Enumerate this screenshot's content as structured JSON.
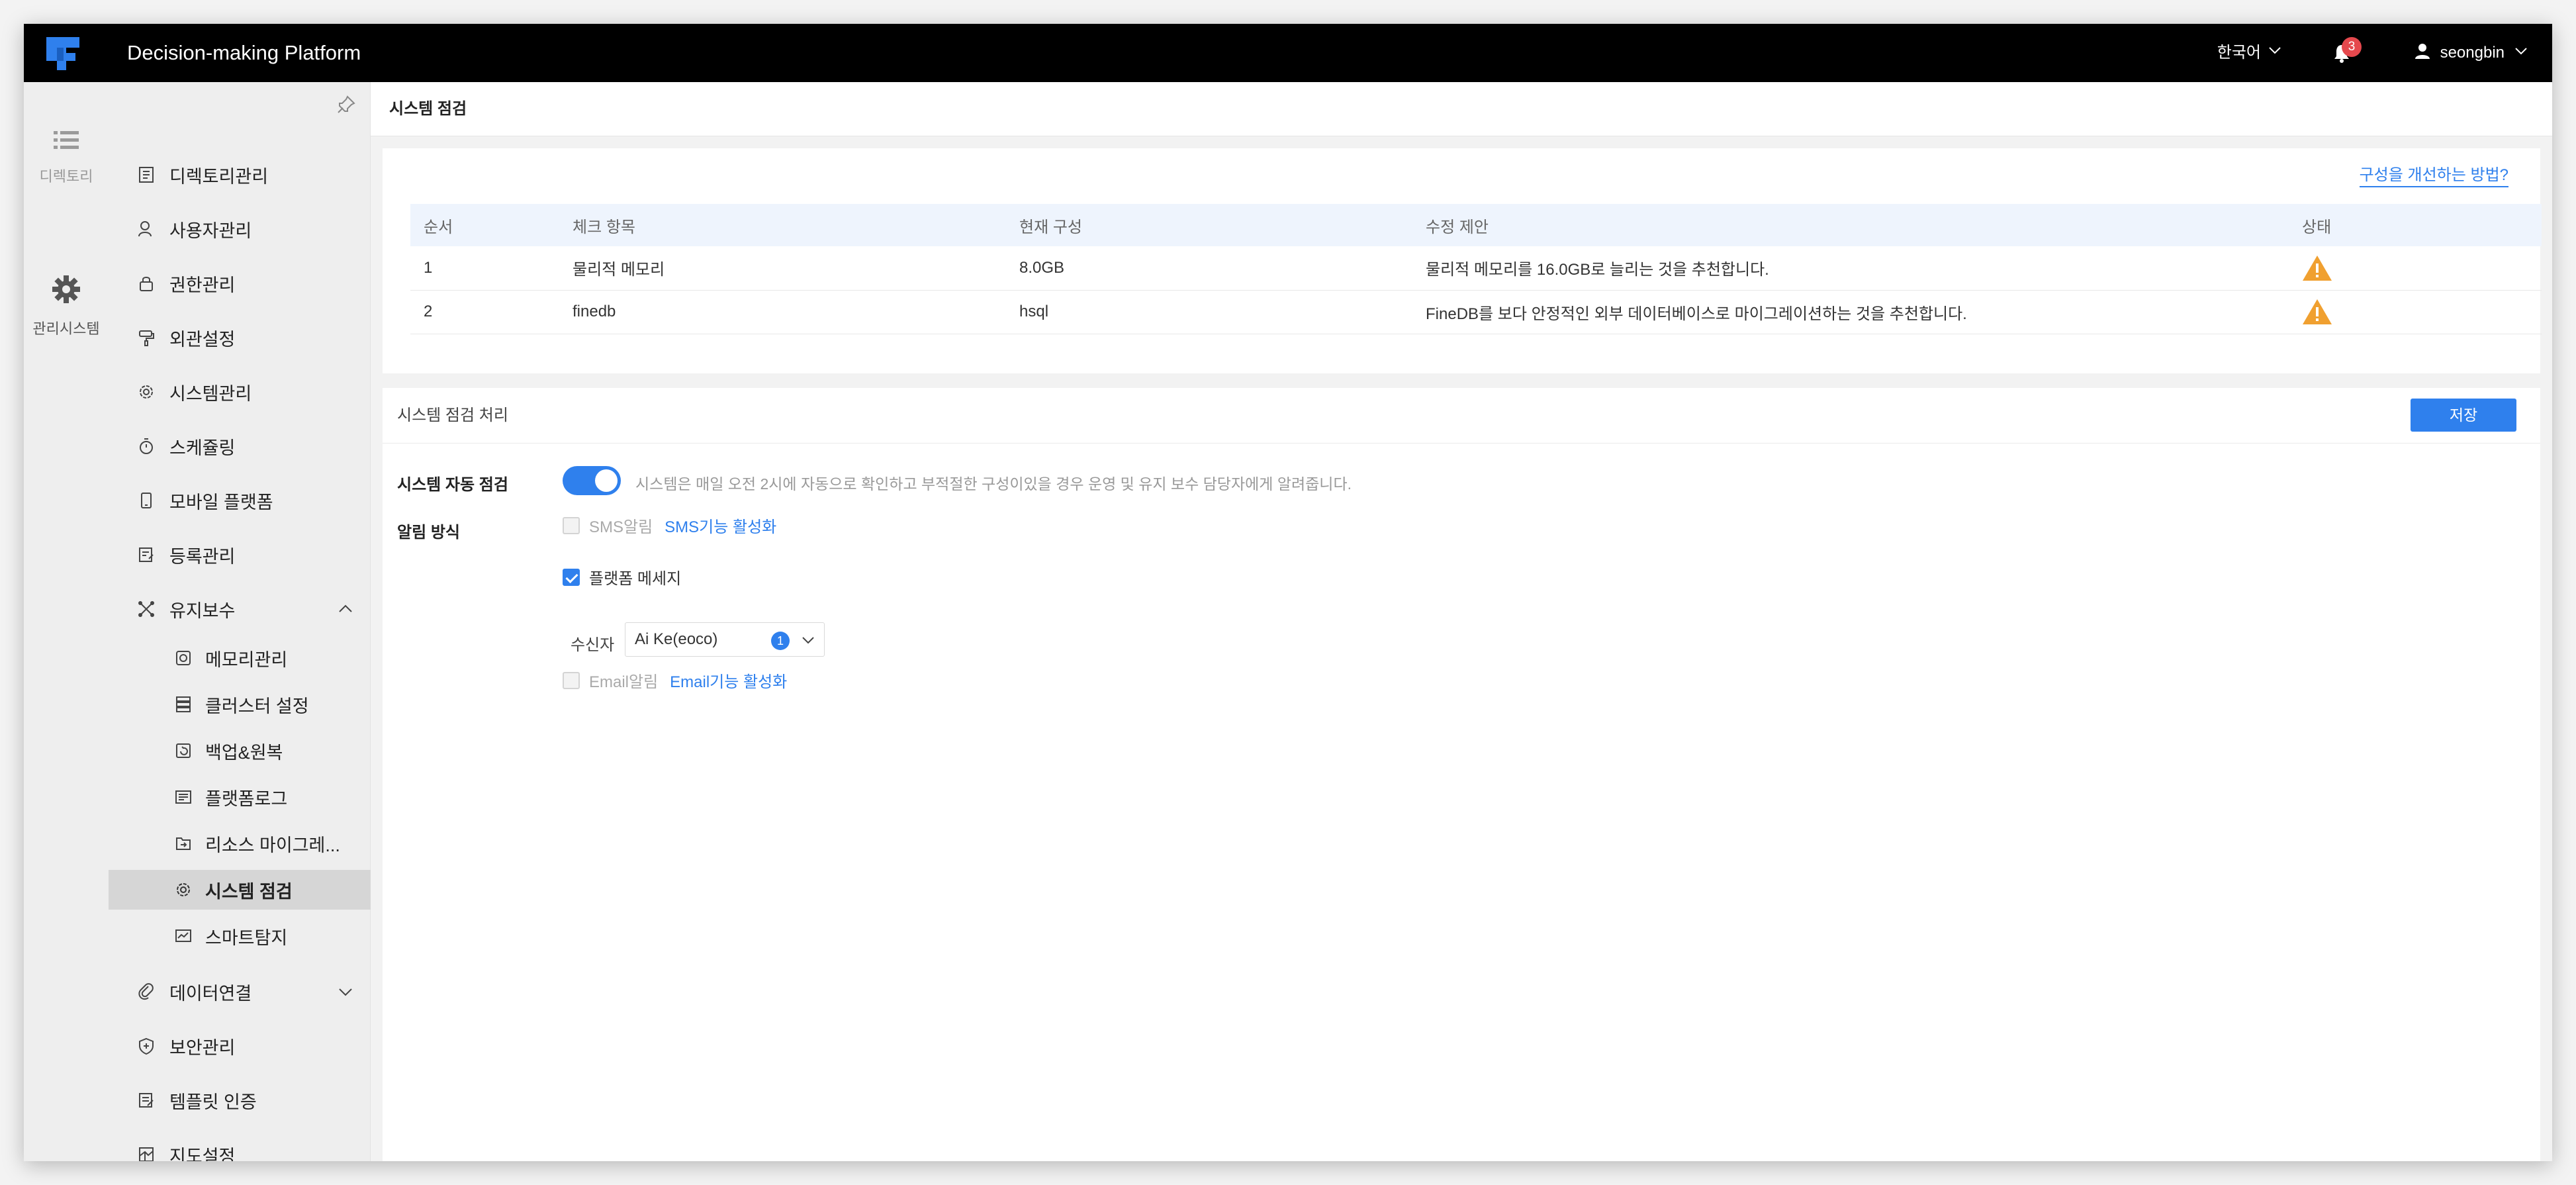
{
  "app": {
    "title": "Decision-making Platform",
    "language": "한국어",
    "notification_count": "3",
    "username": "seongbin",
    "accent_color": "#2f80ed"
  },
  "rail": {
    "items": [
      {
        "label": "디렉토리",
        "icon": "list-icon"
      },
      {
        "label": "관리시스템",
        "icon": "gear-icon"
      }
    ]
  },
  "sidebar": {
    "items": [
      {
        "label": "디렉토리관리",
        "icon": "directory-icon"
      },
      {
        "label": "사용자관리",
        "icon": "user-icon"
      },
      {
        "label": "권한관리",
        "icon": "lock-icon"
      },
      {
        "label": "외관설정",
        "icon": "paint-icon"
      },
      {
        "label": "시스템관리",
        "icon": "gear-icon"
      },
      {
        "label": "스케쥴링",
        "icon": "timer-icon"
      },
      {
        "label": "모바일 플랫폼",
        "icon": "mobile-icon"
      },
      {
        "label": "등록관리",
        "icon": "register-icon"
      },
      {
        "label": "유지보수",
        "icon": "maintenance-icon",
        "expanded": true
      },
      {
        "label": "데이터연결",
        "icon": "link-icon"
      },
      {
        "label": "보안관리",
        "icon": "shield-icon"
      },
      {
        "label": "템플릿 인증",
        "icon": "template-icon"
      },
      {
        "label": "지도설정",
        "icon": "map-icon"
      }
    ],
    "subitems": [
      {
        "label": "메모리관리",
        "icon": "memory-icon"
      },
      {
        "label": "클러스터 설정",
        "icon": "cluster-icon"
      },
      {
        "label": "백업&원복",
        "icon": "backup-icon"
      },
      {
        "label": "플랫폼로그",
        "icon": "log-icon"
      },
      {
        "label": "리소스 마이그레...",
        "icon": "migrate-icon"
      },
      {
        "label": "시스템 점검",
        "icon": "gear-icon",
        "selected": true
      },
      {
        "label": "스마트탐지",
        "icon": "monitor-icon"
      }
    ]
  },
  "page": {
    "title": "시스템 점검",
    "help_link": "구성을 개선하는 방법?",
    "table": {
      "headers": [
        "순서",
        "체크 항목",
        "현재 구성",
        "수정 제안",
        "상태"
      ],
      "rows": [
        {
          "index": "1",
          "item": "물리적 메모리",
          "current": "8.0GB",
          "suggestion": "물리적 메모리를 16.0GB로 늘리는 것을 추천합니다.",
          "status": "warning"
        },
        {
          "index": "2",
          "item": "finedb",
          "current": "hsql",
          "suggestion": "FineDB를 보다 안정적인 외부 데이터베이스로 마이그레이션하는 것을 추천합니다.",
          "status": "warning"
        }
      ]
    },
    "processing": {
      "title": "시스템 점검 처리",
      "save_label": "저장",
      "auto_check_label": "시스템 자동 점검",
      "auto_check_on": true,
      "auto_check_desc": "시스템은 매일 오전 2시에 자동으로 확인하고 부적절한 구성이있을 경우 운영 및 유지 보수 담당자에게 알려줍니다.",
      "notify_label": "알림 방식",
      "sms_label": "SMS알림",
      "sms_link": "SMS기능 활성화",
      "platform_msg_label": "플랫폼 메세지",
      "recipient_label": "수신자",
      "recipient_value": "Ai Ke(eoco)",
      "recipient_count": "1",
      "email_label": "Email알림",
      "email_link": "Email기능 활성화"
    }
  }
}
